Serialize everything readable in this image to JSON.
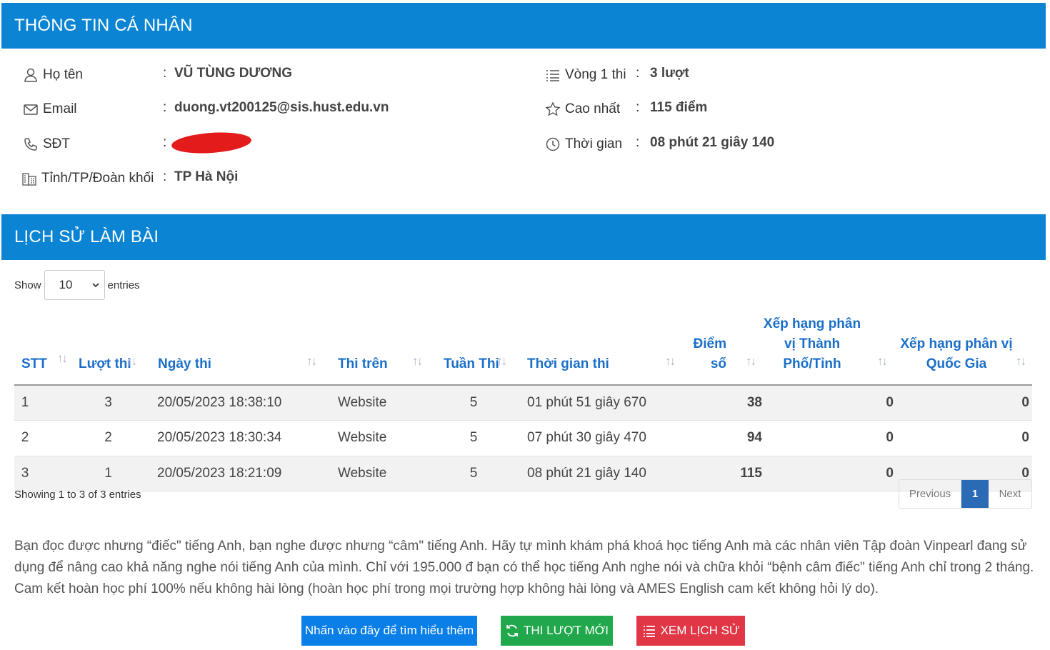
{
  "personal": {
    "title": "THÔNG TIN CÁ NHÂN",
    "name_label": "Họ tên",
    "name_value": "VŨ TÙNG DƯƠNG",
    "email_label": "Email",
    "email_value": "duong.vt200125@sis.hust.edu.vn",
    "phone_label": "SĐT",
    "phone_value": "",
    "region_label": "Tỉnh/TP/Đoàn khối",
    "region_value": "TP Hà Nội",
    "round_label": "Vòng 1 thi",
    "round_value": "3 lượt",
    "best_label": "Cao nhất",
    "best_value": "115 điểm",
    "time_label": "Thời gian",
    "time_value": "08 phút 21 giây 140",
    "colon": ":"
  },
  "history": {
    "title": "LỊCH SỬ LÀM BÀI",
    "show_label": "Show",
    "entries_label": "entries",
    "page_size": "10",
    "columns": [
      "STT",
      "Lượt thi",
      "Ngày thi",
      "Thi trên",
      "Tuần Thi",
      "Thời gian thi",
      "Điểm số",
      "Xếp hạng phân vị Thành Phố/Tỉnh",
      "Xếp hạng phân vị Quốc Gia"
    ],
    "rows": [
      [
        "1",
        "3",
        "20/05/2023 18:38:10",
        "Website",
        "5",
        "01 phút 51 giây 670",
        "38",
        "0",
        "0"
      ],
      [
        "2",
        "2",
        "20/05/2023 18:30:34",
        "Website",
        "5",
        "07 phút 30 giây 470",
        "94",
        "0",
        "0"
      ],
      [
        "3",
        "1",
        "20/05/2023 18:21:09",
        "Website",
        "5",
        "08 phút 21 giây 140",
        "115",
        "0",
        "0"
      ]
    ],
    "showing_text": "Showing 1 to 3 of 3 entries",
    "pager_prev": "Previous",
    "pager_current": "1",
    "pager_next": "Next"
  },
  "promo": {
    "text": "Bạn đọc được nhưng “điếc\" tiếng Anh, bạn nghe được nhưng “câm\" tiếng Anh. Hãy tự mình khám phá khoá học tiếng Anh mà các nhân viên Tập đoàn Vinpearl đang sử dụng để nâng cao khả năng nghe nói tiếng Anh của mình. Chỉ với 195.000 đ bạn có thể học tiếng Anh nghe nói và chữa khỏi “bệnh câm điếc\" tiếng Anh chỉ trong 2 tháng. Cam kết hoàn học phí 100% nếu không hài lòng (hoàn học phí trong mọi trường hợp không hài lòng và AMES English cam kết không hỏi lý do).",
    "learn_more": "Nhấn vào đây để tìm hiểu thêm",
    "new_attempt": "THI LƯỢT MỚI",
    "view_history": "XEM LỊCH SỬ"
  },
  "colors": {
    "header_blue": "#0b85d3",
    "table_head": "#1a6fc9",
    "btn_blue": "#0b7fe8",
    "btn_green": "#22a84c",
    "btn_red": "#e03645",
    "redaction": "#e31b1b"
  }
}
